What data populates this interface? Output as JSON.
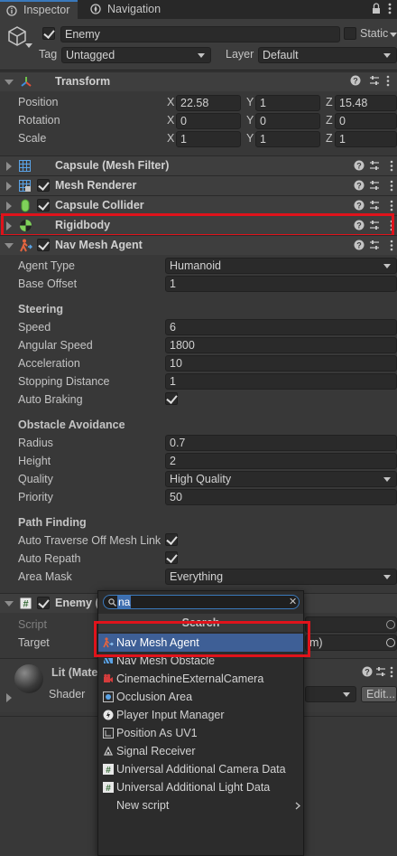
{
  "tabs": [
    {
      "label": "Inspector",
      "icon": "info-icon",
      "active": true
    },
    {
      "label": "Navigation",
      "icon": "compass-icon",
      "active": false
    }
  ],
  "object": {
    "name": "Enemy",
    "active": true,
    "static_label": "Static",
    "tag_label": "Tag",
    "tag_value": "Untagged",
    "layer_label": "Layer",
    "layer_value": "Default"
  },
  "transform": {
    "title": "Transform",
    "rows": [
      {
        "label": "Position",
        "x": "22.58",
        "y": "1",
        "z": "15.48"
      },
      {
        "label": "Rotation",
        "x": "0",
        "y": "0",
        "z": "0"
      },
      {
        "label": "Scale",
        "x": "1",
        "y": "1",
        "z": "1"
      }
    ],
    "axis": [
      "X",
      "Y",
      "Z"
    ]
  },
  "components": [
    {
      "title": "Capsule (Mesh Filter)",
      "icon": "mesh-filter-icon",
      "checkbox": false
    },
    {
      "title": "Mesh Renderer",
      "icon": "mesh-renderer-icon",
      "checkbox": true
    },
    {
      "title": "Capsule Collider",
      "icon": "capsule-collider-icon",
      "checkbox": true
    },
    {
      "title": "Rigidbody",
      "icon": "rigidbody-icon",
      "checkbox": false
    },
    {
      "title": "Nav Mesh Agent",
      "icon": "nav-mesh-agent-icon",
      "checkbox": true
    }
  ],
  "nav_agent": {
    "agent_type_label": "Agent Type",
    "agent_type_value": "Humanoid",
    "base_offset_label": "Base Offset",
    "base_offset_value": "1",
    "steering": "Steering",
    "speed_label": "Speed",
    "speed_value": "6",
    "angular_label": "Angular Speed",
    "angular_value": "1800",
    "accel_label": "Acceleration",
    "accel_value": "10",
    "stopping_label": "Stopping Distance",
    "stopping_value": "1",
    "braking_label": "Auto Braking",
    "obstacle": "Obstacle Avoidance",
    "radius_label": "Radius",
    "radius_value": "0.7",
    "height_label": "Height",
    "height_value": "2",
    "quality_label": "Quality",
    "quality_value": "High Quality",
    "priority_label": "Priority",
    "priority_value": "50",
    "pathfinding": "Path Finding",
    "traverse_label": "Auto Traverse Off Mesh Link",
    "repath_label": "Auto Repath",
    "areamask_label": "Area Mask",
    "areamask_value": "Everything"
  },
  "enemy_script": {
    "title": "Enemy (",
    "script_label": "Script",
    "target_label": "Target",
    "target_value_fragment": "m)"
  },
  "material": {
    "title": "Lit (Mate",
    "shader_label": "Shader",
    "edit_label": "Edit..."
  },
  "search_popup": {
    "query": "na",
    "header": "Search",
    "items": [
      {
        "label": "Nav Mesh Agent",
        "icon": "nav-mesh-agent-icon",
        "selected": true
      },
      {
        "label": "Nav Mesh Obstacle",
        "icon": "nav-mesh-obstacle-icon"
      },
      {
        "label": "CinemachineExternalCamera",
        "icon": "cinemachine-icon"
      },
      {
        "label": "Occlusion Area",
        "icon": "occlusion-area-icon"
      },
      {
        "label": "Player Input Manager",
        "icon": "input-manager-icon"
      },
      {
        "label": "Position As UV1",
        "icon": "uv-icon"
      },
      {
        "label": "Signal Receiver",
        "icon": "signal-receiver-icon"
      },
      {
        "label": "Universal Additional Camera Data",
        "icon": "script-icon"
      },
      {
        "label": "Universal Additional Light Data",
        "icon": "script-icon"
      },
      {
        "label": "New script",
        "icon": "",
        "submenu": true
      }
    ]
  },
  "colors": {
    "highlight_red": "#e0131b",
    "selection_blue": "#3e5f96",
    "accent_blue": "#3a79bb"
  }
}
